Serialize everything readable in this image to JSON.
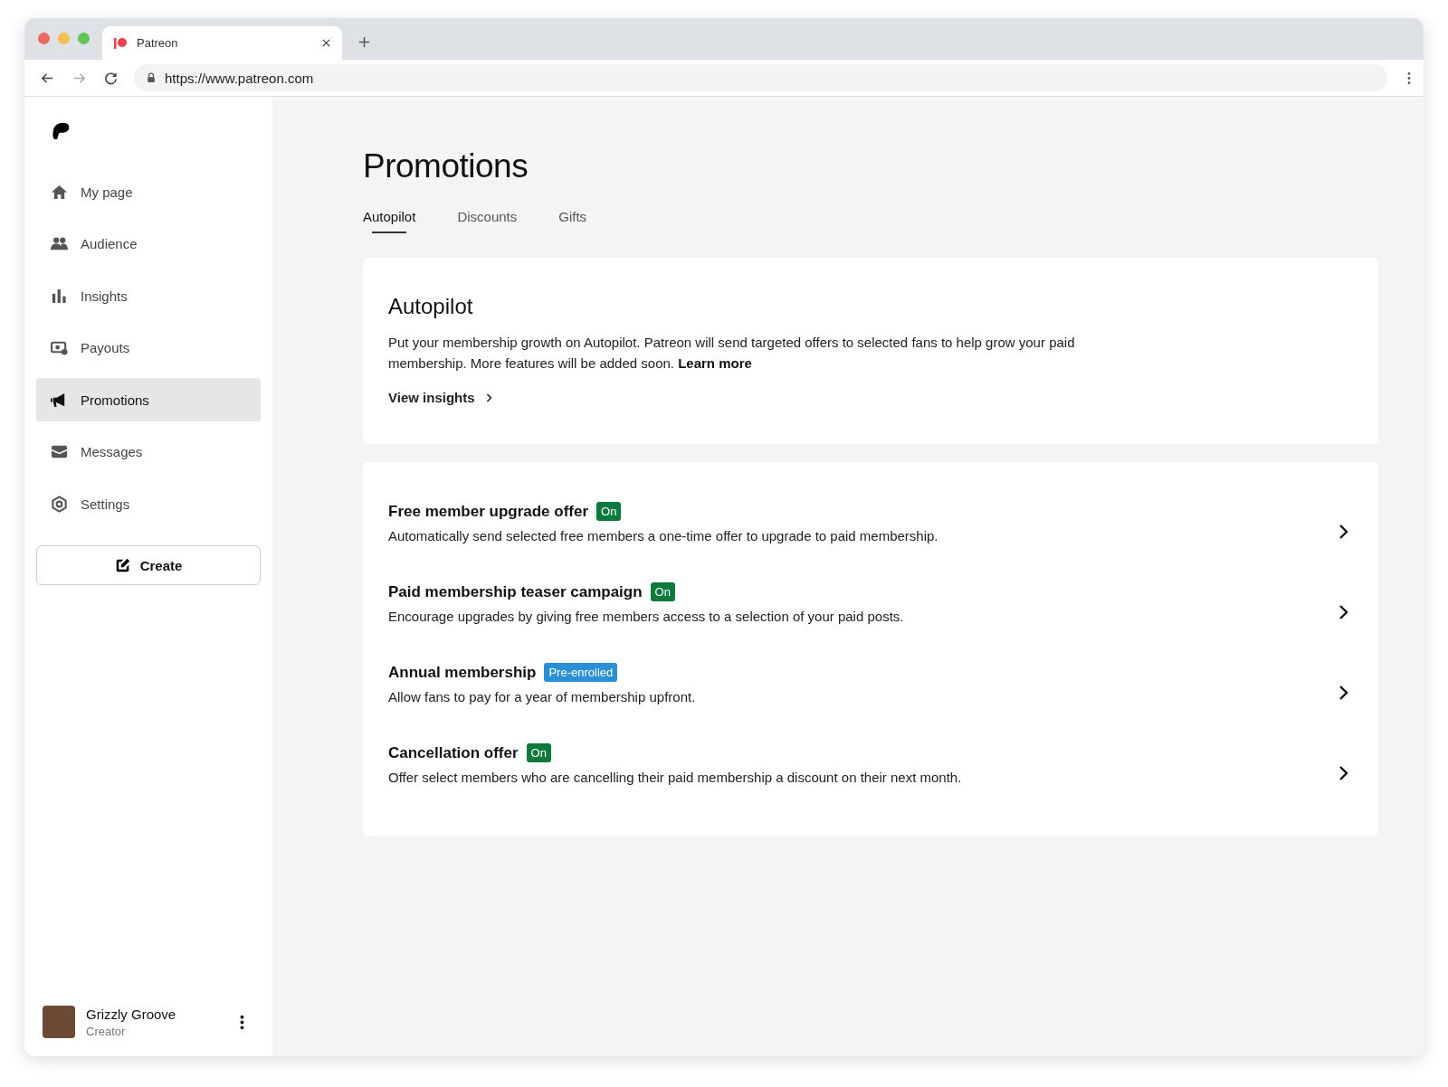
{
  "browser": {
    "tab_title": "Patreon",
    "url": "https://www.patreon.com"
  },
  "sidebar": {
    "items": [
      {
        "label": "My page",
        "selected": false
      },
      {
        "label": "Audience",
        "selected": false
      },
      {
        "label": "Insights",
        "selected": false
      },
      {
        "label": "Payouts",
        "selected": false
      },
      {
        "label": "Promotions",
        "selected": true
      },
      {
        "label": "Messages",
        "selected": false
      },
      {
        "label": "Settings",
        "selected": false
      }
    ],
    "create_button": "Create",
    "user": {
      "name": "Grizzly Groove",
      "role": "Creator"
    }
  },
  "page": {
    "title": "Promotions",
    "tabs": [
      {
        "label": "Autopilot",
        "selected": true
      },
      {
        "label": "Discounts",
        "selected": false
      },
      {
        "label": "Gifts",
        "selected": false
      }
    ],
    "intro": {
      "heading": "Autopilot",
      "text": "Put your membership growth on Autopilot. Patreon will send targeted offers to selected fans to help grow your paid membership. More features will be added soon.",
      "link": "Learn more",
      "action": "View insights"
    },
    "offers": [
      {
        "title": "Free member upgrade offer",
        "badge": "On",
        "color": "#0b7a3b",
        "description": "Automatically send selected free members a one-time offer to upgrade to paid membership."
      },
      {
        "title": "Paid membership teaser campaign",
        "badge": "On",
        "color": "#0b7a3b",
        "description": "Encourage upgrades by giving free members access to a selection of your paid posts."
      },
      {
        "title": "Annual membership",
        "badge": "Pre-enrolled",
        "color": "#2a8fd6",
        "description": "Allow fans to pay for a year of membership upfront."
      },
      {
        "title": "Cancellation offer",
        "badge": "On",
        "color": "#0b7a3b",
        "description": "Offer select members who are cancelling their paid membership a discount on their next month."
      }
    ]
  }
}
